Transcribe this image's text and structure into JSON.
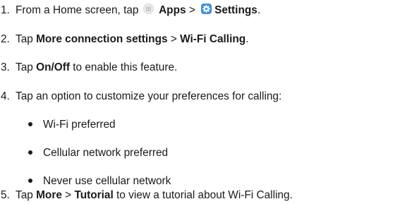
{
  "steps": [
    {
      "num": "1.",
      "pre": "From a Home screen, tap",
      "apps_icon": "apps-grid-icon",
      "apps": "Apps",
      "sep": ">",
      "settings_icon": "settings-gear-icon",
      "settings": "Settings",
      "post": "."
    },
    {
      "num": "2.",
      "pre": "Tap",
      "b1": "More connection settings",
      "sep": ">",
      "b2": "Wi-Fi Calling",
      "post": "."
    },
    {
      "num": "3.",
      "pre": "Tap",
      "b1": "On/Off",
      "post": "to enable this feature."
    },
    {
      "num": "4.",
      "text": "Tap an option to customize your preferences for calling:"
    },
    {
      "num": "5.",
      "pre": "Tap",
      "b1": "More",
      "sep": ">",
      "b2": "Tutorial",
      "post": "to view a tutorial about Wi-Fi Calling."
    }
  ],
  "options": [
    "Wi-Fi preferred",
    "Cellular network preferred",
    "Never use cellular network"
  ],
  "colors": {
    "text": "#1a1a1a",
    "settings_icon": "#3a8fd6",
    "apps_icon": "#ececec"
  }
}
